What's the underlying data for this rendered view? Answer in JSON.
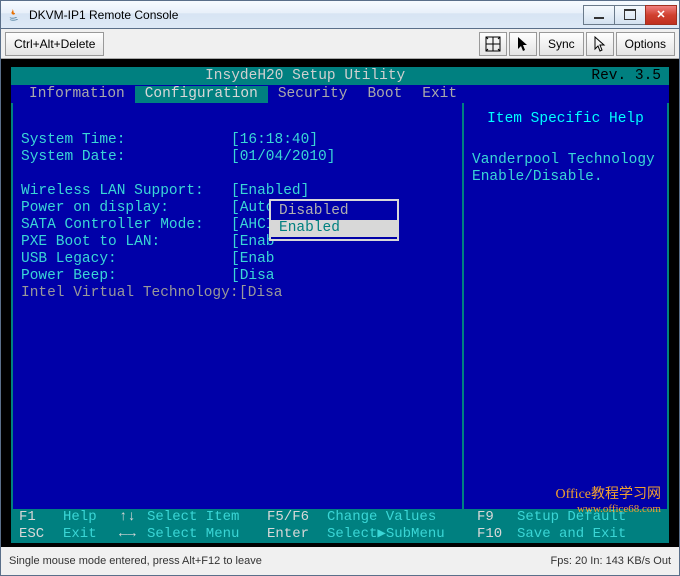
{
  "window": {
    "title": "DKVM-IP1 Remote Console"
  },
  "toolbar": {
    "cad": "Ctrl+Alt+Delete",
    "sync": "Sync",
    "options": "Options"
  },
  "bios": {
    "header_title": "InsydeH20 Setup Utility",
    "rev": "Rev. 3.5",
    "menu": {
      "information": "Information",
      "configuration": "Configuration",
      "security": "Security",
      "boot": "Boot",
      "exit": "Exit"
    },
    "rows": {
      "system_time": {
        "label": "System Time:",
        "value": "[16:18:40]"
      },
      "system_date": {
        "label": "System Date:",
        "value": "[01/04/2010]"
      },
      "wlan": {
        "label": "Wireless LAN Support:",
        "value": "[Enabled]"
      },
      "power_display": {
        "label": "Power on display:",
        "value": "[Auto-Selected]"
      },
      "sata": {
        "label": "SATA Controller Mode:",
        "value": "[AHCI]"
      },
      "pxe": {
        "label": "PXE Boot to LAN:",
        "value": "[Enab"
      },
      "usb": {
        "label": "USB Legacy:",
        "value": "[Enab"
      },
      "beep": {
        "label": "Power Beep:",
        "value": "[Disa"
      },
      "ivt": {
        "label": "Intel Virtual Technology:",
        "value": "[Disa"
      }
    },
    "popup": {
      "disabled": "Disabled",
      "enabled": "Enabled"
    },
    "help": {
      "title": "Item Specific Help",
      "text1": "Vanderpool Technology",
      "text2": "Enable/Disable."
    },
    "footer": {
      "f1": "F1",
      "help": "Help",
      "updown": "↑↓",
      "select_item": "Select Item",
      "f5f6": "F5/F6",
      "change_values": "Change Values",
      "f9": "F9",
      "setup_default": "Setup Default",
      "esc": "ESC",
      "exit": "Exit",
      "leftright": "←→",
      "select_menu": "Select Menu",
      "enter": "Enter",
      "select_submenu": "Select▶SubMenu",
      "f10": "F10",
      "save_exit": "Save and Exit"
    }
  },
  "status": {
    "left": "Single mouse mode entered, press Alt+F12 to leave",
    "right": "Fps: 20 In: 143 KB/s Out"
  },
  "watermark": {
    "line1": "Office教程学习网",
    "line2": "www.office68.com"
  }
}
